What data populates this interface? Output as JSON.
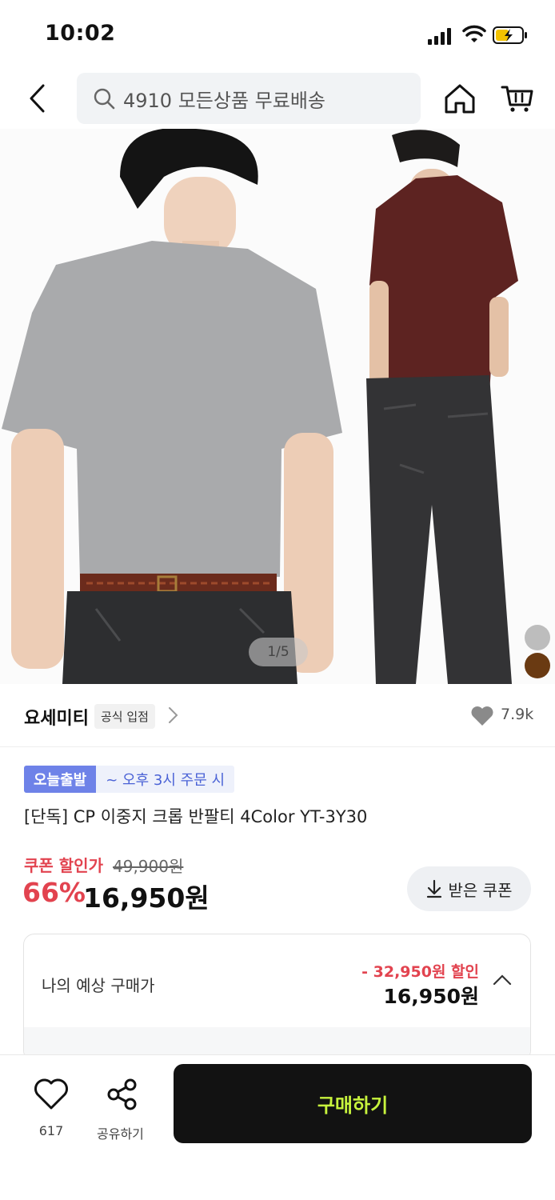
{
  "status": {
    "time": "10:02"
  },
  "search": {
    "text": "4910 모든상품 무료배송"
  },
  "hero": {
    "pager": "1/5",
    "swatches": [
      "#bdbdbd",
      "#6a3a12"
    ]
  },
  "store": {
    "name": "요세미티",
    "badge": "공식 입점",
    "likes": "7.9k"
  },
  "product": {
    "tag_primary": "오늘출발",
    "tag_secondary": "~ 오후 3시 주문 시",
    "title": "[단독] CP 이중지 크롭 반팔티 4Color YT-3Y30",
    "coupon_label": "쿠폰 할인가",
    "original_price": "49,900원",
    "discount": "66%",
    "price": "16,950원",
    "coupon_button": "받은 쿠폰"
  },
  "expected": {
    "label": "나의 예상 구매가",
    "saving": "- 32,950원 할인",
    "final": "16,950원"
  },
  "bottom": {
    "like_count": "617",
    "share_label": "공유하기",
    "buy_label": "구매하기"
  },
  "colors": {
    "accent_red": "#e2434f",
    "tag_blue": "#6e82e8",
    "buy_bg": "#121212",
    "buy_text": "#c7f33d"
  }
}
